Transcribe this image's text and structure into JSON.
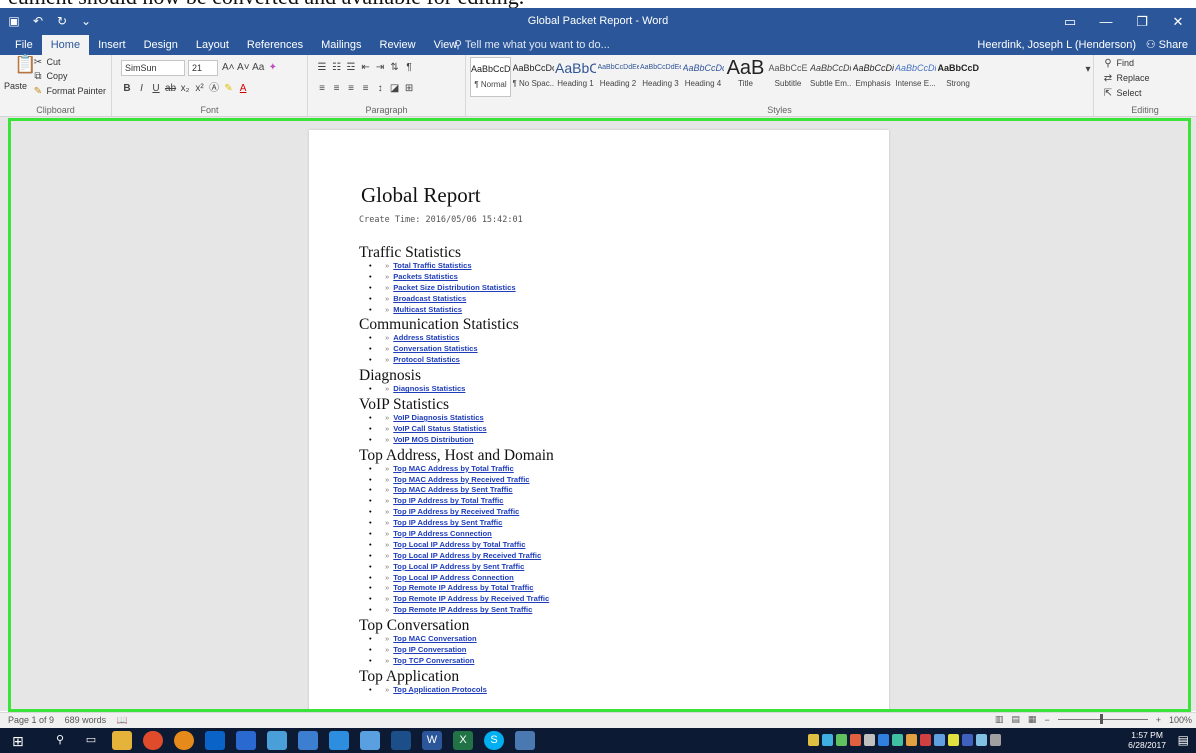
{
  "caption_text": "cument should now be converted and available for editing.",
  "window": {
    "title": "Global Packet Report - Word",
    "quick_access": [
      "save-icon",
      "undo-icon",
      "redo-icon",
      "customize-icon"
    ],
    "controls": [
      "ribbon-display-icon",
      "minimize-icon",
      "restore-icon",
      "close-icon"
    ]
  },
  "tabs": [
    {
      "label": "File"
    },
    {
      "label": "Home",
      "active": true
    },
    {
      "label": "Insert"
    },
    {
      "label": "Design"
    },
    {
      "label": "Layout"
    },
    {
      "label": "References"
    },
    {
      "label": "Mailings"
    },
    {
      "label": "Review"
    },
    {
      "label": "View"
    }
  ],
  "tell_me": "Tell me what you want to do...",
  "user": "Heerdink, Joseph L (Henderson)",
  "share": "Share",
  "ribbon": {
    "clipboard": {
      "cut": "Cut",
      "copy": "Copy",
      "paste": "Paste",
      "format_painter": "Format Painter",
      "label": "Clipboard"
    },
    "font": {
      "name": "SimSun",
      "size": "21",
      "label": "Font"
    },
    "paragraph": {
      "label": "Paragraph"
    },
    "styles": {
      "label": "Styles",
      "items": [
        {
          "preview": "AaBbCcDc",
          "name": "¶ Normal",
          "active": true
        },
        {
          "preview": "AaBbCcDc",
          "name": "¶ No Spac..."
        },
        {
          "preview": "AaBbC(",
          "name": "Heading 1"
        },
        {
          "preview": "AaBbCcDdEe",
          "name": "Heading 2"
        },
        {
          "preview": "AaBbCcDdEe",
          "name": "Heading 3"
        },
        {
          "preview": "AaBbCcDc",
          "name": "Heading 4"
        },
        {
          "preview": "AaB",
          "name": "Title"
        },
        {
          "preview": "AaBbCcE",
          "name": "Subtitle"
        },
        {
          "preview": "AaBbCcDi",
          "name": "Subtle Em..."
        },
        {
          "preview": "AaBbCcDi",
          "name": "Emphasis"
        },
        {
          "preview": "AaBbCcDi",
          "name": "Intense E..."
        },
        {
          "preview": "AaBbCcDc",
          "name": "Strong"
        }
      ]
    },
    "editing": {
      "find": "Find",
      "replace": "Replace",
      "select": "Select",
      "label": "Editing"
    }
  },
  "document": {
    "title": "Global Report",
    "create_time": "Create Time: 2016/05/06 15:42:01",
    "sections": [
      {
        "heading": "Traffic Statistics",
        "links": [
          "Total Traffic Statistics",
          "Packets Statistics",
          "Packet Size Distribution Statistics",
          "Broadcast Statistics",
          "Multicast Statistics"
        ]
      },
      {
        "heading": "Communication Statistics",
        "links": [
          "Address Statistics",
          "Conversation Statistics",
          "Protocol Statistics"
        ]
      },
      {
        "heading": "Diagnosis",
        "links": [
          "Diagnosis Statistics"
        ]
      },
      {
        "heading": "VoIP Statistics",
        "links": [
          "VoIP Diagnosis Statistics",
          "VoIP Call Status Statistics",
          "VoIP MOS Distribution"
        ]
      },
      {
        "heading": "Top Address, Host and Domain",
        "links": [
          "Top MAC Address by Total Traffic",
          "Top MAC Address by Received Traffic",
          "Top MAC Address by Sent Traffic",
          "Top IP Address by Total Traffic",
          "Top IP Address by Received Traffic",
          "Top IP Address by Sent Traffic",
          "Top IP Address Connection",
          "Top Local IP Address by Total Traffic",
          "Top Local IP Address by Received Traffic",
          "Top Local IP Address by Sent Traffic",
          "Top Local IP Address Connection",
          "Top Remote IP Address by Total Traffic",
          "Top Remote IP Address by Received Traffic",
          "Top Remote IP Address by Sent Traffic"
        ]
      },
      {
        "heading": "Top Conversation",
        "links": [
          "Top MAC Conversation",
          "Top IP Conversation",
          "Top TCP Conversation"
        ]
      },
      {
        "heading": "Top Application",
        "links": [
          "Top Application Protocols"
        ]
      }
    ]
  },
  "status": {
    "page": "Page 1 of 9",
    "words": "689 words",
    "zoom": "100%"
  },
  "taskbar": {
    "time": "1:57 PM",
    "date": "6/28/2017"
  },
  "colors": {
    "word_blue": "#2b579a",
    "link": "#1f3dbb",
    "highlight_frame": "#39e339",
    "taskbar": "#0d1a33"
  }
}
